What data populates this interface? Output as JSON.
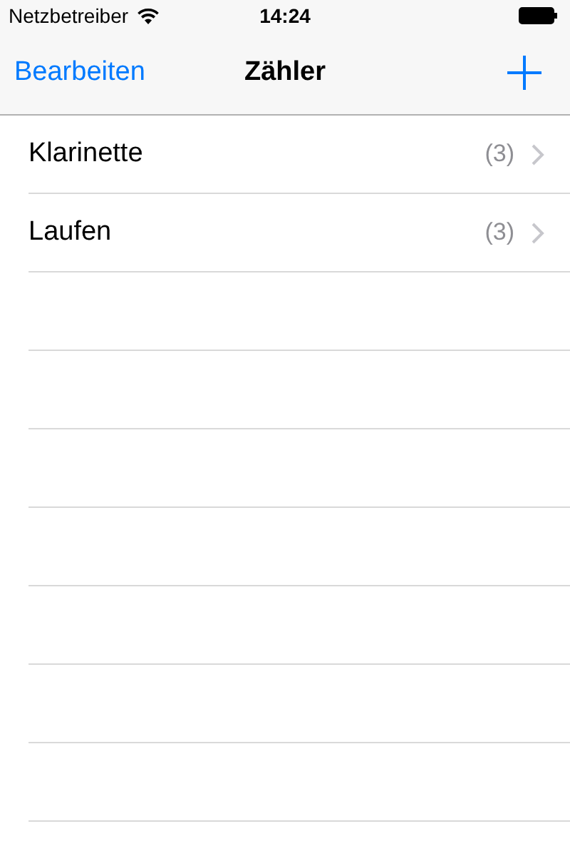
{
  "status_bar": {
    "carrier": "Netzbetreiber",
    "time": "14:24"
  },
  "nav_bar": {
    "left_button": "Bearbeiten",
    "title": "Zähler"
  },
  "rows": [
    {
      "title": "Klarinette",
      "count": "(3)"
    },
    {
      "title": "Laufen",
      "count": "(3)"
    }
  ]
}
